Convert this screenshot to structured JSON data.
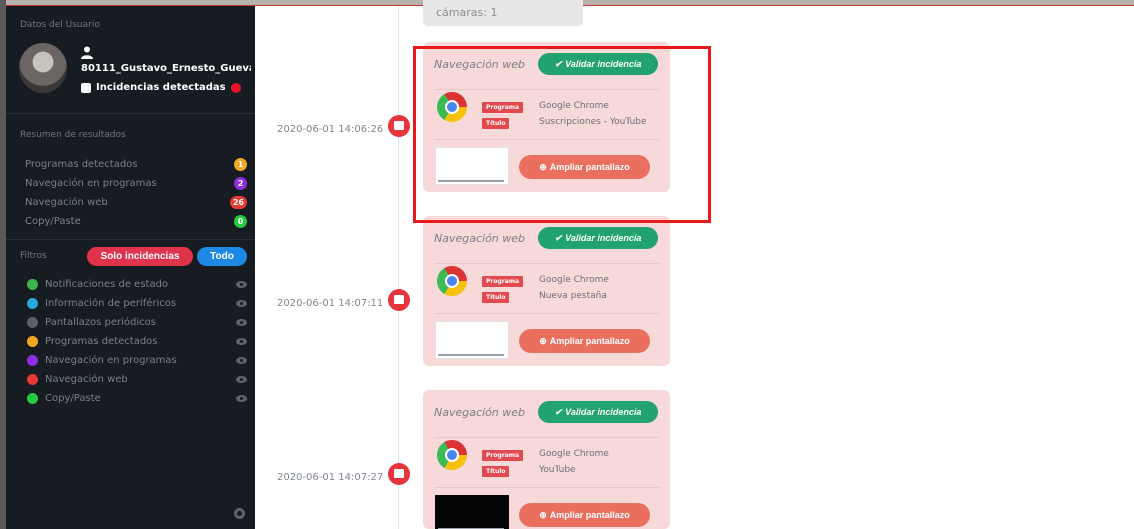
{
  "sidebar": {
    "title": "Datos del Usuario",
    "user_name": "80111_Gustavo_Ernesto_Gueva",
    "incidencias_label": "Incidencias detectadas",
    "results_title": "Resumen de resultados",
    "results": [
      {
        "label": "Programas detectados",
        "count": "1",
        "color": "#f5a623"
      },
      {
        "label": "Navegación en programas",
        "count": "2",
        "color": "#8e2de2"
      },
      {
        "label": "Navegación web",
        "count": "26",
        "color": "#e53935"
      },
      {
        "label": "Copy/Paste",
        "count": "0",
        "color": "#27c93f"
      }
    ],
    "filters_title": "Filtros",
    "btn_solo": "Solo incidencias",
    "btn_todo": "Todo",
    "filters": [
      {
        "label": "Notificaciones de estado",
        "color": "#3cb54a",
        "icon": "info-icon"
      },
      {
        "label": "Información de periféricos",
        "color": "#29a7df",
        "icon": "device-icon"
      },
      {
        "label": "Pantallazos periódicos",
        "color": "#5a6069",
        "icon": "camera-icon"
      },
      {
        "label": "Programas detectados",
        "color": "#f5a623",
        "icon": "program-icon"
      },
      {
        "label": "Navegación en programas",
        "color": "#8e2de2",
        "icon": "window-icon"
      },
      {
        "label": "Navegación web",
        "color": "#e53935",
        "icon": "browser-icon"
      },
      {
        "label": "Copy/Paste",
        "color": "#27c93f",
        "icon": "clipboard-icon"
      }
    ]
  },
  "timeline": {
    "top_card_text": "cámaras: 1",
    "items": [
      {
        "timestamp": "2020-06-01 14:06:26",
        "title": "Navegación web",
        "validar_label": "Validar incidencia",
        "programa_tag": "Programa",
        "programa": "Google Chrome",
        "titulo_tag": "Título",
        "titulo": "Suscripciones - YouTube",
        "ampliar_label": "Ampliar pantallazo"
      },
      {
        "timestamp": "2020-06-01 14:07:11",
        "title": "Navegación web",
        "validar_label": "Validar incidencia",
        "programa_tag": "Programa",
        "programa": "Google Chrome",
        "titulo_tag": "Título",
        "titulo": "Nueva pestaña",
        "ampliar_label": "Ampliar pantallazo"
      },
      {
        "timestamp": "2020-06-01 14:07:27",
        "title": "Navegación web",
        "validar_label": "Validar incidencia",
        "programa_tag": "Programa",
        "programa": "Google Chrome",
        "titulo_tag": "Título",
        "titulo": "YouTube",
        "ampliar_label": "Ampliar pantallazo"
      }
    ]
  }
}
